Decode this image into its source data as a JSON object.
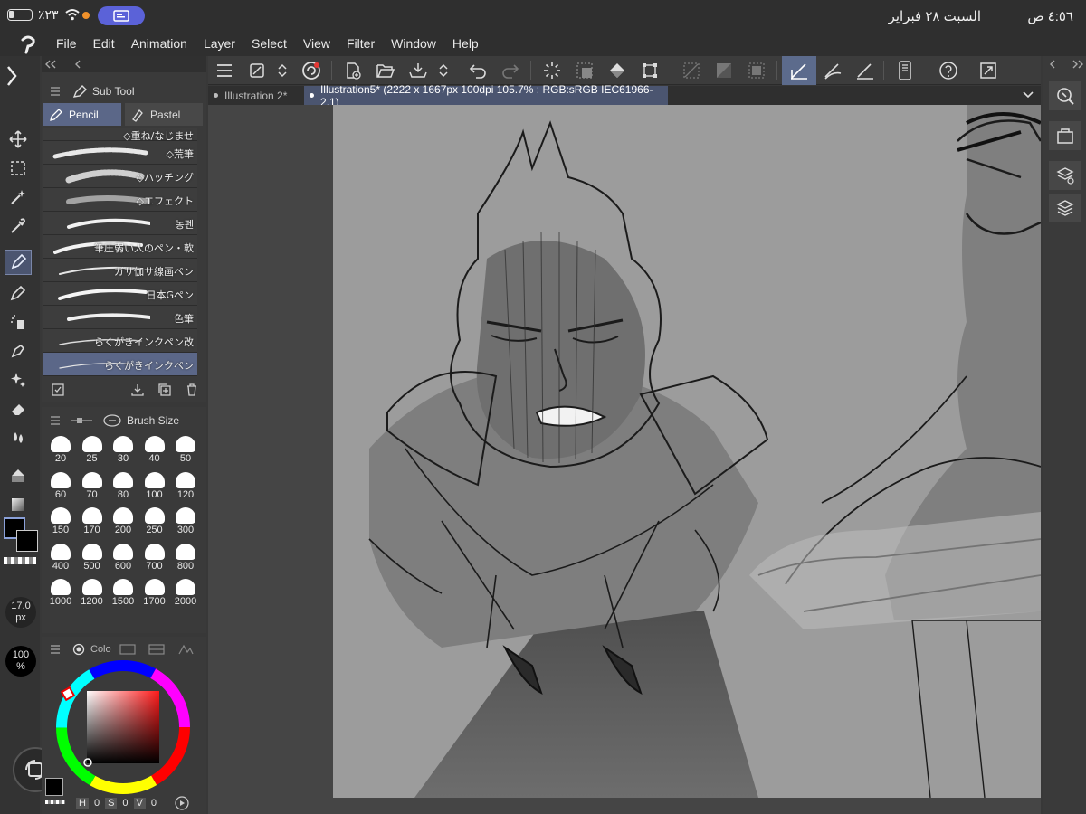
{
  "status": {
    "battery_text": "٪٢٣",
    "date": "السبت ٢٨ فبراير",
    "time": "٤:٥٦ ص"
  },
  "menu": {
    "items": [
      "File",
      "Edit",
      "Animation",
      "Layer",
      "Select",
      "View",
      "Filter",
      "Window",
      "Help"
    ]
  },
  "tabs": [
    {
      "label": "Illustration 2*"
    },
    {
      "label": "Illustration5* (2222 x 1667px 100dpi 105.7% : RGB:sRGB IEC61966-2.1)"
    }
  ],
  "subtool": {
    "title": "Sub Tool",
    "tabs": [
      "Pencil",
      "Pastel"
    ],
    "brushes": [
      {
        "name": "◇重ね/なじませ"
      },
      {
        "name": "◇荒筆"
      },
      {
        "name": "◇ハッチング"
      },
      {
        "name": "◇エフェクト"
      },
      {
        "name": "농펜"
      },
      {
        "name": "筆圧弱い人のペン・軟"
      },
      {
        "name": "ガサ伽サ線画ペン"
      },
      {
        "name": "日本Gペン"
      },
      {
        "name": "色筆"
      },
      {
        "name": "らくがきインクペン改"
      },
      {
        "name": "らくがきインクペン"
      }
    ]
  },
  "brush_size": {
    "title": "Brush Size",
    "sizes": [
      "20",
      "25",
      "30",
      "40",
      "50",
      "60",
      "70",
      "80",
      "100",
      "120",
      "150",
      "170",
      "200",
      "250",
      "300",
      "400",
      "500",
      "600",
      "700",
      "800",
      "1000",
      "1200",
      "1500",
      "1700",
      "2000"
    ]
  },
  "left_toolbar": {
    "size_value": "17.0",
    "size_unit": "px",
    "opacity_value": "100",
    "opacity_unit": "%"
  },
  "color_panel": {
    "tab_label": "Colo",
    "h_label": "H",
    "h_value": "0",
    "s_label": "S",
    "s_value": "0",
    "v_label": "V",
    "v_value": "0"
  },
  "colors": {
    "accent": "#5b6788",
    "canvas": "#9c9c9c",
    "record_dot": "#f0912b",
    "screen_badge": "#5b62d8"
  }
}
